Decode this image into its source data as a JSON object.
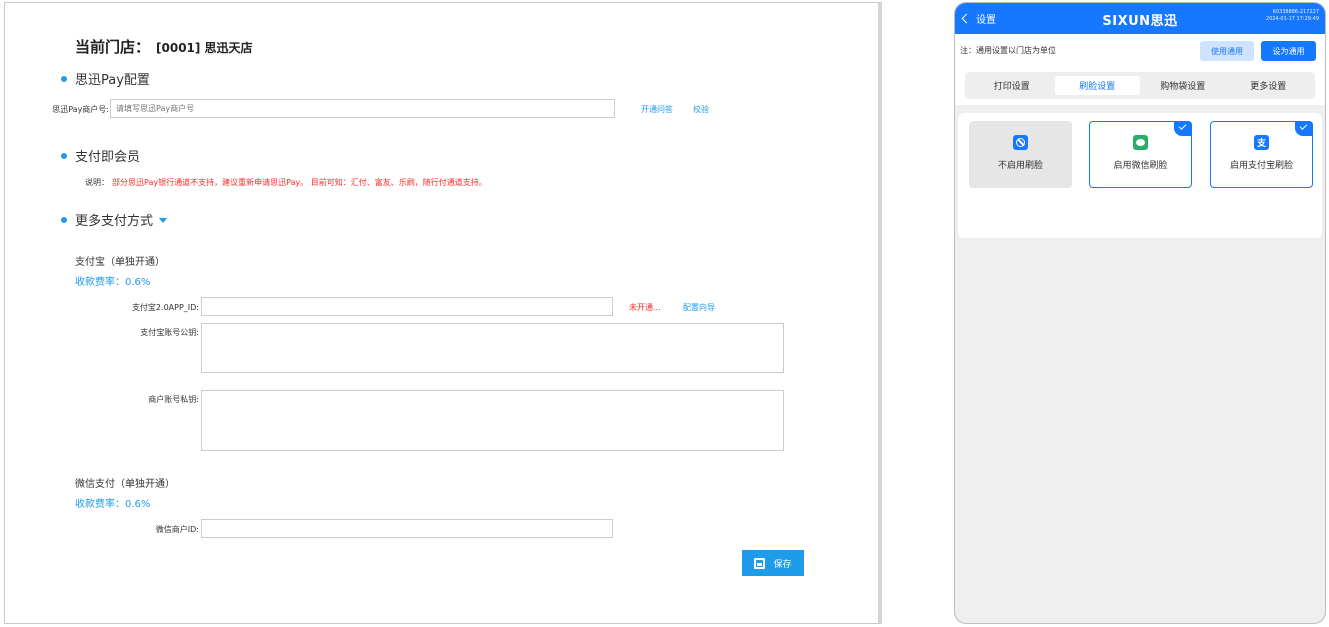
{
  "web": {
    "store_label": "当前门店：",
    "store_value": "[0001] 思迅天店",
    "pay_section_title": "思迅Pay配置",
    "merchant_label": "思迅Pay商户号:",
    "merchant_placeholder": "请填写思迅Pay商户号",
    "open_faq_link": "开通问答",
    "verify_link": "校验",
    "member_section_title": "支付即会员",
    "note_label": "说明：",
    "note_text": "部分思迅Pay银行通道不支持，建议重新申请思迅Pay。 目前可知：汇付、富友、乐刷，随行付通道支持。",
    "more_section_title": "更多支付方式",
    "alipay_title": "支付宝（单独开通）",
    "alipay_rate": "收款费率：0.6%",
    "alipay_appid_label": "支付宝2.0APP_ID:",
    "alipay_status": "未开通...",
    "config_guide_link": "配置向导",
    "alipay_pubkey_label": "支付宝账号公钥:",
    "merchant_privkey_label": "商户账号私钥:",
    "wechat_title": "微信支付（单独开通）",
    "wechat_rate": "收款费率：0.6%",
    "wechat_merchant_label": "微信商户ID:",
    "save_label": "保存"
  },
  "tablet": {
    "back_label": "设置",
    "logo": "SIXUN思迅",
    "meta_line1": "60338886-217227",
    "meta_line2": "2024-01-17 17:29:49",
    "note": "注：通用设置以门店为单位",
    "use_general_label": "使用通用",
    "set_general_label": "设为通用",
    "tabs": [
      "打印设置",
      "刷脸设置",
      "购物袋设置",
      "更多设置"
    ],
    "active_tab": 1,
    "cards": [
      {
        "label": "不启用刷脸",
        "icon": "disabled-icon",
        "selected": false
      },
      {
        "label": "启用微信刷脸",
        "icon": "wechat-icon",
        "selected": true
      },
      {
        "label": "启用支付宝刷脸",
        "icon": "alipay-icon",
        "selected": true
      }
    ],
    "alipay_glyph": "支",
    "colors": {
      "brand": "#1677ff",
      "wechat": "#2aae67",
      "web_accent": "#1e9be9",
      "alert": "#ff2a2a"
    }
  }
}
